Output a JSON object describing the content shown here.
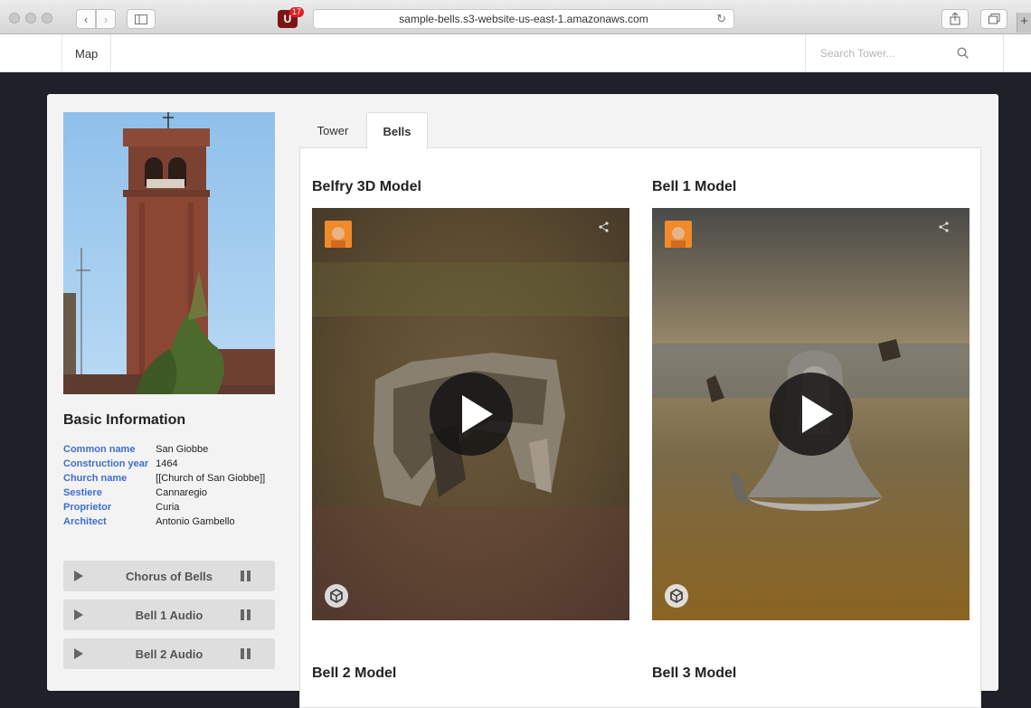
{
  "browser": {
    "url": "sample-bells.s3-website-us-east-1.amazonaws.com",
    "extension_badge": "17",
    "extension_letter": "U",
    "new_tab": "+"
  },
  "nav": {
    "map_label": "Map",
    "search_placeholder": "Search Tower..."
  },
  "sidebar": {
    "basic_info_title": "Basic Information",
    "info": [
      {
        "key": "Common name",
        "value": "San Giobbe"
      },
      {
        "key": "Construction year",
        "value": "1464"
      },
      {
        "key": "Church name",
        "value": "[[Church of San Giobbe]]"
      },
      {
        "key": "Sestiere",
        "value": "Cannaregio"
      },
      {
        "key": "Proprietor",
        "value": "Curia"
      },
      {
        "key": "Architect",
        "value": "Antonio Gambello"
      }
    ],
    "audio": [
      {
        "label": "Chorus of Bells"
      },
      {
        "label": "Bell 1 Audio"
      },
      {
        "label": "Bell 2 Audio"
      }
    ]
  },
  "tabs": [
    {
      "label": "Tower",
      "active": false
    },
    {
      "label": "Bells",
      "active": true
    }
  ],
  "models": [
    {
      "title": "Belfry 3D Model"
    },
    {
      "title": "Bell 1 Model"
    },
    {
      "title": "Bell 2 Model"
    },
    {
      "title": "Bell 3 Model"
    }
  ],
  "icons": {
    "back": "chevron-left-icon",
    "forward": "chevron-right-icon",
    "sidebar": "sidebar-icon",
    "reload": "reload-icon",
    "share": "share-icon",
    "tabs": "tabs-icon",
    "search": "search-icon",
    "play": "play-icon",
    "pause": "pause-icon"
  },
  "colors": {
    "link_blue": "#3e6ed0",
    "page_dark": "#1f2128",
    "card": "#f3f3f3",
    "avatar_orange": "#f08a2a"
  }
}
